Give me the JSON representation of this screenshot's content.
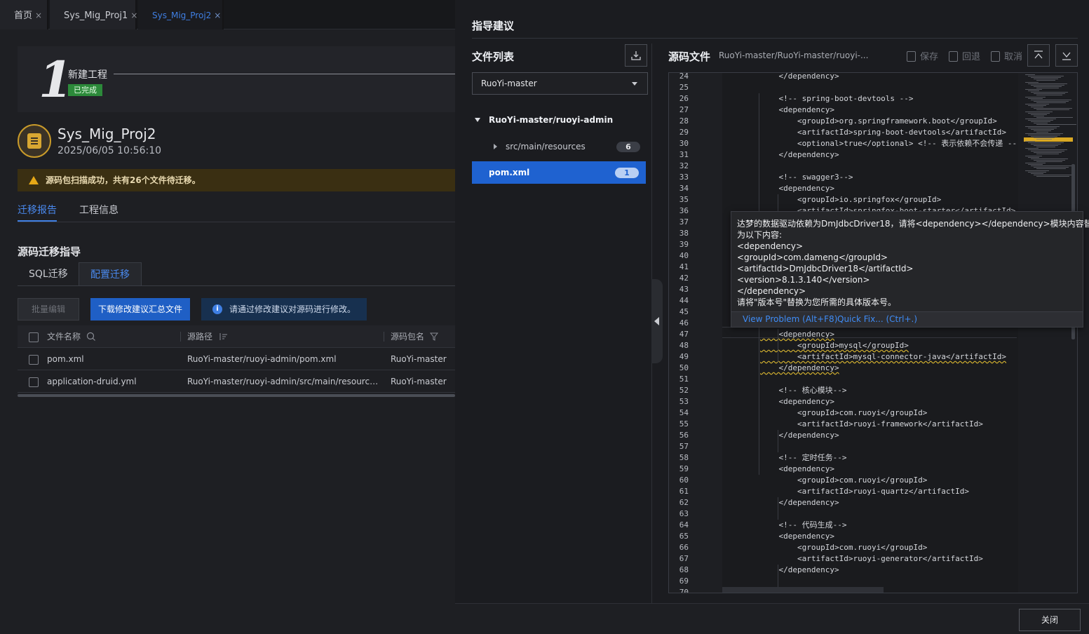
{
  "tabs": [
    "首页",
    "Sys_Mig_Proj1",
    "Sys_Mig_Proj2"
  ],
  "tab_close": "×",
  "project": {
    "step_number": "1",
    "step_title": "新建工程",
    "step_status": "已完成",
    "name": "Sys_Mig_Proj2",
    "time": "2025/06/05 10:56:10",
    "warning": "源码包扫描成功，共有26个文件待迁移。"
  },
  "report_tabs": [
    "迁移报告",
    "工程信息"
  ],
  "section_title": "源码迁移指导",
  "sub_tabs": [
    "SQL迁移",
    "配置迁移"
  ],
  "buttons": {
    "batch_edit": "批量编辑",
    "download": "下载修改建议汇总文件",
    "info": "请通过修改建议对源码进行修改。",
    "close": "关闭"
  },
  "table": {
    "columns": [
      "文件名称",
      "源路径",
      "源码包名"
    ],
    "rows": [
      {
        "name": "pom.xml",
        "path": "RuoYi-master/ruoyi-admin/pom.xml",
        "pkg": "RuoYi-master"
      },
      {
        "name": "application-druid.yml",
        "path": "RuoYi-master/ruoyi-admin/src/main/resources/...",
        "pkg": "RuoYi-master"
      }
    ]
  },
  "drawer": {
    "title": "指导建议",
    "file_list_title": "文件列表",
    "package_select": "RuoYi-master",
    "tree_root": "RuoYi-master/ruoyi-admin",
    "tree_child": "src/main/resources",
    "tree_child_count": "6",
    "selected_file": "pom.xml",
    "selected_count": "1",
    "source_title": "源码文件",
    "source_path": "RuoYi-master/RuoYi-master/ruoyi-...",
    "actions": [
      "保存",
      "回退",
      "取消"
    ]
  },
  "code": [
    {
      "n": "24",
      "t": "    </dependency>"
    },
    {
      "n": "25",
      "t": ""
    },
    {
      "n": "26",
      "t": "    <!-- spring-boot-devtools -->"
    },
    {
      "n": "27",
      "t": "    <dependency>"
    },
    {
      "n": "28",
      "t": "        <groupId>org.springframework.boot</groupId>"
    },
    {
      "n": "29",
      "t": "        <artifactId>spring-boot-devtools</artifactId>"
    },
    {
      "n": "30",
      "t": "        <optional>true</optional> <!-- 表示依赖不会传递 -->"
    },
    {
      "n": "31",
      "t": "    </dependency>"
    },
    {
      "n": "32",
      "t": ""
    },
    {
      "n": "33",
      "t": "    <!-- swagger3-->"
    },
    {
      "n": "34",
      "t": "    <dependency>"
    },
    {
      "n": "35",
      "t": "        <groupId>io.springfox</groupId>"
    },
    {
      "n": "36",
      "t": "        <artifactId>springfox-boot-starter</artifactId>"
    },
    {
      "n": "37",
      "t": ""
    },
    {
      "n": "38",
      "t": ""
    },
    {
      "n": "39",
      "t": ""
    },
    {
      "n": "40",
      "t": ""
    },
    {
      "n": "41",
      "t": ""
    },
    {
      "n": "42",
      "t": ""
    },
    {
      "n": "43",
      "t": ""
    },
    {
      "n": "44",
      "t": ""
    },
    {
      "n": "45",
      "t": ""
    },
    {
      "n": "46",
      "t": ""
    },
    {
      "n": "47",
      "t": "    <dependency>"
    },
    {
      "n": "48",
      "t": "        <groupId>mysql</groupId>"
    },
    {
      "n": "49",
      "t": "        <artifactId>mysql-connector-java</artifactId>"
    },
    {
      "n": "50",
      "t": "    </dependency>"
    },
    {
      "n": "51",
      "t": ""
    },
    {
      "n": "52",
      "t": "    <!-- 核心模块-->"
    },
    {
      "n": "53",
      "t": "    <dependency>"
    },
    {
      "n": "54",
      "t": "        <groupId>com.ruoyi</groupId>"
    },
    {
      "n": "55",
      "t": "        <artifactId>ruoyi-framework</artifactId>"
    },
    {
      "n": "56",
      "t": "    </dependency>"
    },
    {
      "n": "57",
      "t": ""
    },
    {
      "n": "58",
      "t": "    <!-- 定时任务-->"
    },
    {
      "n": "59",
      "t": "    <dependency>"
    },
    {
      "n": "60",
      "t": "        <groupId>com.ruoyi</groupId>"
    },
    {
      "n": "61",
      "t": "        <artifactId>ruoyi-quartz</artifactId>"
    },
    {
      "n": "62",
      "t": "    </dependency>"
    },
    {
      "n": "63",
      "t": ""
    },
    {
      "n": "64",
      "t": "    <!-- 代码生成-->"
    },
    {
      "n": "65",
      "t": "    <dependency>"
    },
    {
      "n": "66",
      "t": "        <groupId>com.ruoyi</groupId>"
    },
    {
      "n": "67",
      "t": "        <artifactId>ruoyi-generator</artifactId>"
    },
    {
      "n": "68",
      "t": "    </dependency>"
    },
    {
      "n": "69",
      "t": ""
    },
    {
      "n": "70",
      "t": "</dependencies>"
    }
  ],
  "hover": {
    "lines": [
      "达梦的数据驱动依赖为DmJdbcDriver18，请将<dependency></dependency>模块内容替换",
      "为以下内容:",
      "<dependency>",
      "<groupId>com.dameng</groupId>",
      "<artifactId>DmJdbcDriver18</artifactId>",
      "<version>8.1.3.140</version>",
      "</dependency>",
      "请将\"版本号\"替换为您所需的具体版本号。"
    ],
    "view_problem": "View Problem (Alt+F8)",
    "quick_fix": "Quick Fix... (Ctrl+.)"
  },
  "colors": {
    "accent": "#1f62d0",
    "warning": "#e6a817",
    "success": "#2c8a3a"
  }
}
